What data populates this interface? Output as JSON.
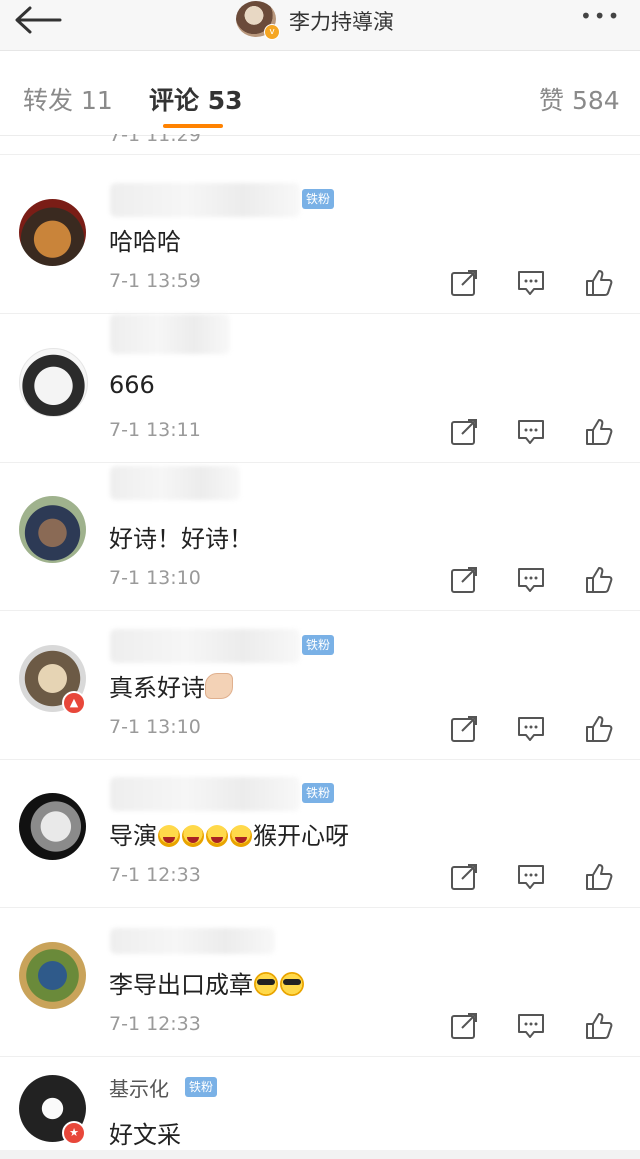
{
  "header": {
    "title": "李力持導演",
    "more_label": "•••",
    "verified_badge": "v"
  },
  "tabs": [
    {
      "label": "转发 11"
    },
    {
      "label": "评论 53"
    },
    {
      "label": "赞 584"
    }
  ],
  "partial_time": "7-1 11:29",
  "fan_badge": "铁粉",
  "comments": [
    {
      "text": "哈哈哈",
      "time": "7-1 13:59"
    },
    {
      "text": "666",
      "time": "7-1 13:11"
    },
    {
      "text": "好诗！好诗！",
      "time": "7-1 13:10"
    },
    {
      "text_a": "真系好诗",
      "time": "7-1 13:10"
    },
    {
      "text_a": "导演",
      "text_b": "猴开心呀",
      "time": "7-1 12:33"
    },
    {
      "text_a": "李导出口成章",
      "time": "7-1 12:33"
    },
    {
      "text": "好文采",
      "username_visible": "基示化"
    }
  ],
  "colors": {
    "accent": "#ff8200",
    "fan_badge": "#7ab1e6",
    "vip_badge": "#e8473a"
  },
  "icons": [
    "back-arrow-icon",
    "more-icon",
    "repost-icon",
    "comment-icon",
    "like-icon"
  ]
}
